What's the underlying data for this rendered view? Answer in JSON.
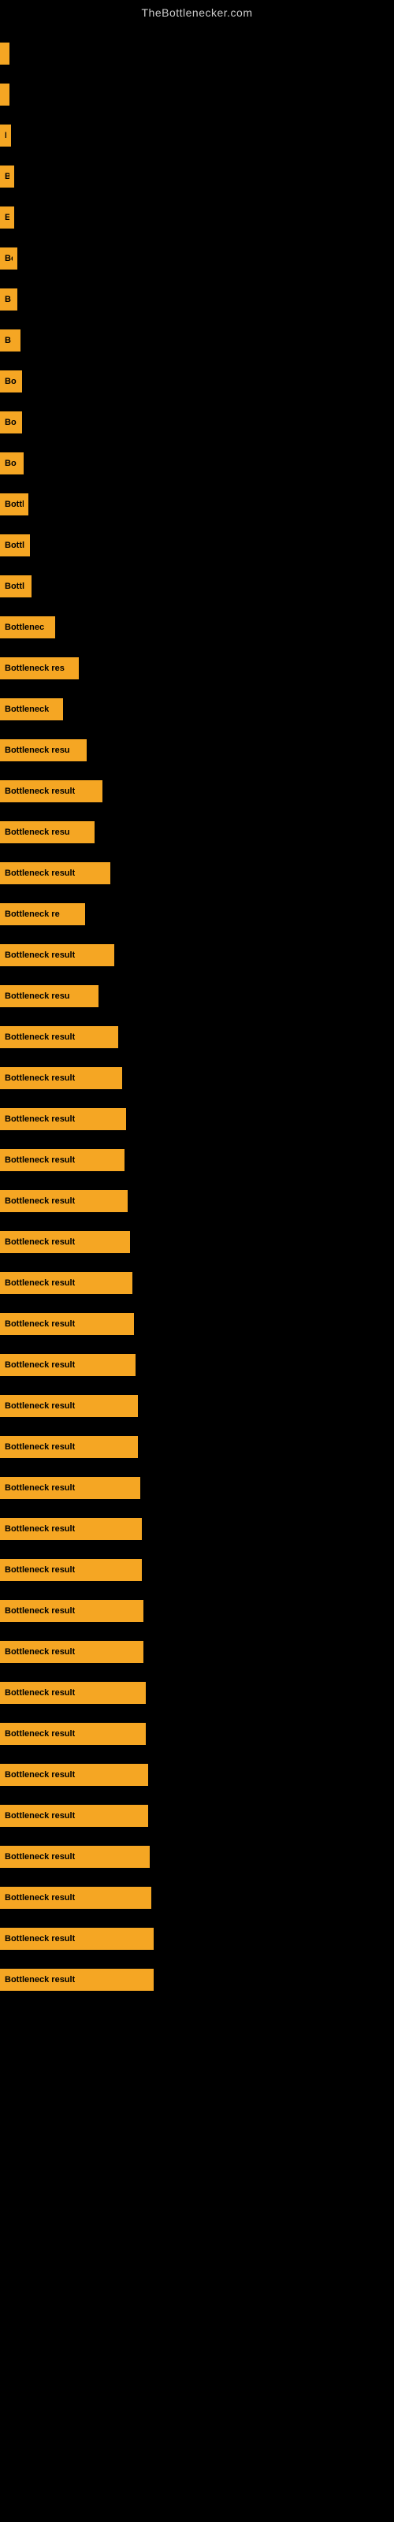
{
  "site": {
    "title": "TheBottlenecker.com"
  },
  "bars": [
    {
      "label": "",
      "width": 4
    },
    {
      "label": "",
      "width": 8
    },
    {
      "label": "E",
      "width": 14
    },
    {
      "label": "B",
      "width": 18
    },
    {
      "label": "E",
      "width": 18
    },
    {
      "label": "Bo",
      "width": 22
    },
    {
      "label": "B",
      "width": 22
    },
    {
      "label": "B",
      "width": 26
    },
    {
      "label": "Bo",
      "width": 28
    },
    {
      "label": "Bo",
      "width": 28
    },
    {
      "label": "Bo",
      "width": 30
    },
    {
      "label": "Bottl",
      "width": 36
    },
    {
      "label": "Bottl",
      "width": 38
    },
    {
      "label": "Bottl",
      "width": 40
    },
    {
      "label": "Bottlenec",
      "width": 70
    },
    {
      "label": "Bottleneck res",
      "width": 100
    },
    {
      "label": "Bottleneck",
      "width": 80
    },
    {
      "label": "Bottleneck resu",
      "width": 110
    },
    {
      "label": "Bottleneck result",
      "width": 130
    },
    {
      "label": "Bottleneck resu",
      "width": 120
    },
    {
      "label": "Bottleneck result",
      "width": 140
    },
    {
      "label": "Bottleneck re",
      "width": 108
    },
    {
      "label": "Bottleneck result",
      "width": 145
    },
    {
      "label": "Bottleneck resu",
      "width": 125
    },
    {
      "label": "Bottleneck result",
      "width": 150
    },
    {
      "label": "Bottleneck result",
      "width": 155
    },
    {
      "label": "Bottleneck result",
      "width": 160
    },
    {
      "label": "Bottleneck result",
      "width": 158
    },
    {
      "label": "Bottleneck result",
      "width": 162
    },
    {
      "label": "Bottleneck result",
      "width": 165
    },
    {
      "label": "Bottleneck result",
      "width": 168
    },
    {
      "label": "Bottleneck result",
      "width": 170
    },
    {
      "label": "Bottleneck result",
      "width": 172
    },
    {
      "label": "Bottleneck result",
      "width": 175
    },
    {
      "label": "Bottleneck result",
      "width": 175
    },
    {
      "label": "Bottleneck result",
      "width": 178
    },
    {
      "label": "Bottleneck result",
      "width": 180
    },
    {
      "label": "Bottleneck result",
      "width": 180
    },
    {
      "label": "Bottleneck result",
      "width": 182
    },
    {
      "label": "Bottleneck result",
      "width": 182
    },
    {
      "label": "Bottleneck result",
      "width": 185
    },
    {
      "label": "Bottleneck result",
      "width": 185
    },
    {
      "label": "Bottleneck result",
      "width": 188
    },
    {
      "label": "Bottleneck result",
      "width": 188
    },
    {
      "label": "Bottleneck result",
      "width": 190
    },
    {
      "label": "Bottleneck result",
      "width": 192
    },
    {
      "label": "Bottleneck result",
      "width": 195
    },
    {
      "label": "Bottleneck result",
      "width": 195
    }
  ]
}
